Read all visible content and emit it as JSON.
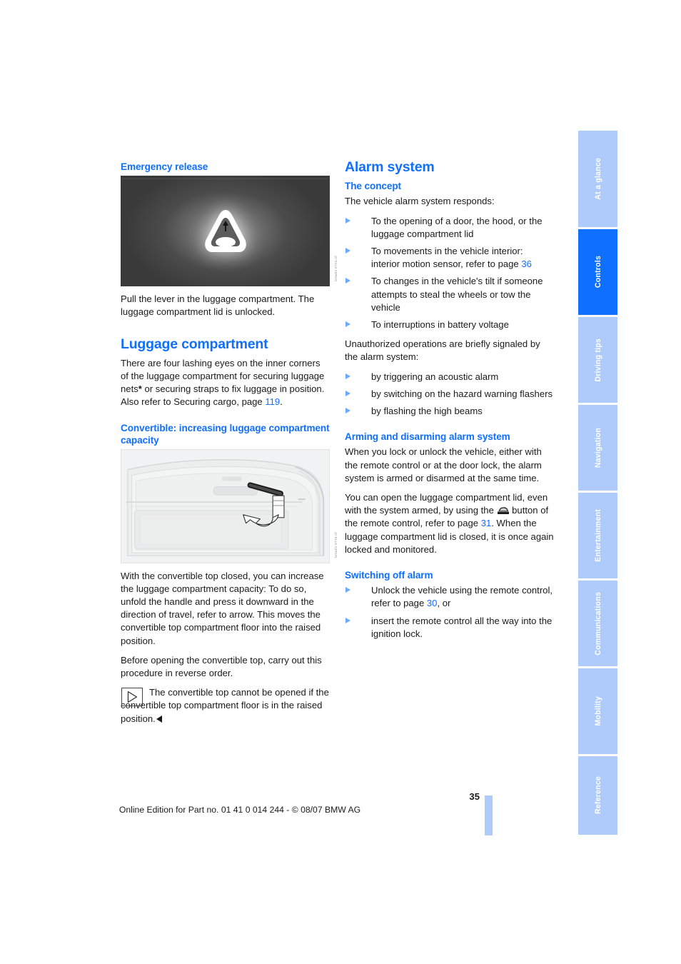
{
  "left_column": {
    "emergency": {
      "heading": "Emergency release",
      "figure_code": "bmw01-0724.tif",
      "body": "Pull the lever in the luggage compartment. The luggage compartment lid is unlocked."
    },
    "luggage": {
      "heading": "Luggage compartment",
      "paragraph_1": "There are four lashing eyes on the inner corners of the luggage compartment for securing luggage nets",
      "paragraph_1_marker": "*",
      "paragraph_1_cont": " or securing straps to fix luggage in position.",
      "paragraph_2_pre": "Also refer to Securing cargo, page ",
      "paragraph_2_page": "119",
      "paragraph_2_post": "."
    },
    "convertible": {
      "heading": "Convertible: increasing luggage compartment capacity",
      "figure_code": "bmw01-0719.tif",
      "paragraph_1": "With the convertible top closed, you can increase the luggage compartment capacity: To do so, unfold the handle and press it downward in the direction of travel, refer to arrow. This moves the convertible top compartment floor into the raised position.",
      "paragraph_2": "Before opening the convertible top, carry out this procedure in reverse order.",
      "note": "The convertible top cannot be opened if the convertible top compartment floor is in the raised position."
    }
  },
  "right_column": {
    "alarm": {
      "heading": "Alarm system",
      "concept": {
        "heading": "The concept",
        "intro": "The vehicle alarm system responds:",
        "items": [
          {
            "text": "To the opening of a door, the hood, or the luggage compartment lid"
          },
          {
            "pre": "To movements in the vehicle interior: interior motion sensor, refer to page ",
            "page": "36",
            "post": ""
          },
          {
            "text": "To changes in the vehicle's tilt if someone attempts to steal the wheels or tow the vehicle"
          },
          {
            "text": "To interruptions in battery voltage"
          }
        ],
        "intro2": "Unauthorized operations are briefly signaled by the alarm system:",
        "items2": [
          {
            "text": "by triggering an acoustic alarm"
          },
          {
            "text": "by switching on the hazard warning flashers"
          },
          {
            "text": "by flashing the high beams"
          }
        ]
      },
      "arming": {
        "heading": "Arming and disarming alarm system",
        "paragraph_1": "When you lock or unlock the vehicle, either with the remote control or at the door lock, the alarm system is armed or disarmed at the same time.",
        "paragraph_2_pre": "You can open the luggage compartment lid, even with the system armed, by using the ",
        "paragraph_2_icon": "trunk-button-icon",
        "paragraph_2_mid": " button of the remote control, refer to page ",
        "paragraph_2_page": "31",
        "paragraph_2_post": ". When the luggage compartment lid is closed, it is once again locked and monitored."
      },
      "switching_off": {
        "heading": "Switching off alarm",
        "items": [
          {
            "pre": "Unlock the vehicle using the remote control, refer to page ",
            "page": "30",
            "post": ", or"
          },
          {
            "text": "insert the remote control all the way into the ignition lock."
          }
        ]
      }
    }
  },
  "tabs": [
    {
      "label": "At a glance",
      "active": false
    },
    {
      "label": "Controls",
      "active": true
    },
    {
      "label": "Driving tips",
      "active": false
    },
    {
      "label": "Navigation",
      "active": false
    },
    {
      "label": "Entertainment",
      "active": false
    },
    {
      "label": "Communications",
      "active": false
    },
    {
      "label": "Mobility",
      "active": false
    },
    {
      "label": "Reference",
      "active": false
    }
  ],
  "footer": {
    "page_number": "35",
    "edition_line": "Online Edition for Part no. 01 41 0 014 244 - © 08/07 BMW AG"
  },
  "colors": {
    "accent_blue": "#0f6fff",
    "tab_blue": "#aecbfb",
    "bullet_blue": "#6aa9ff"
  }
}
